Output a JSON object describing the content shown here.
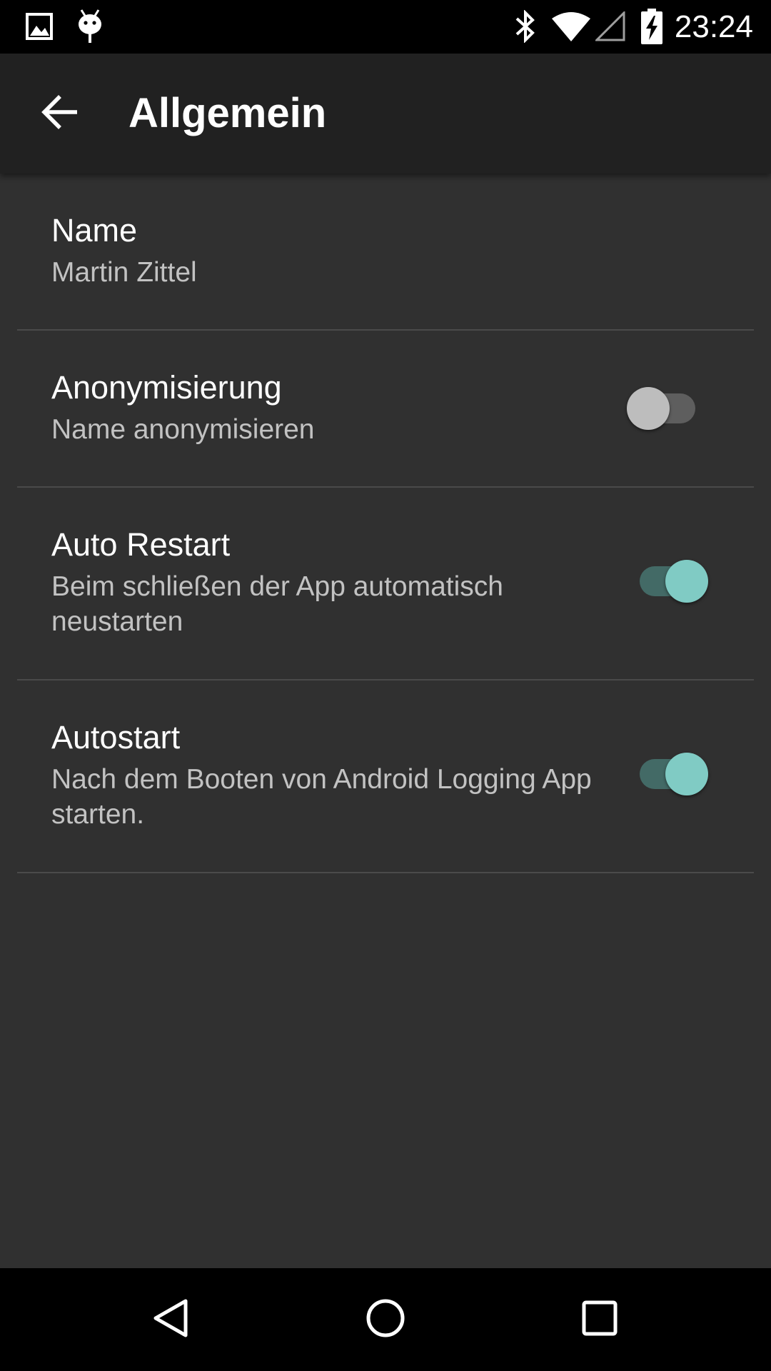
{
  "status_bar": {
    "time": "23:24",
    "left_icons": [
      "image-notification-icon",
      "android-debug-icon"
    ],
    "right_icons": [
      "bluetooth-icon",
      "wifi-icon",
      "cell-signal-icon",
      "battery-charging-icon"
    ]
  },
  "toolbar": {
    "title": "Allgemein",
    "back_icon": "arrow-back-icon"
  },
  "preferences": [
    {
      "title": "Name",
      "summary": "Martin Zittel",
      "has_switch": false
    },
    {
      "title": "Anonymisierung",
      "summary": "Name anonymisieren",
      "has_switch": true,
      "checked": false
    },
    {
      "title": "Auto Restart",
      "summary": "Beim schließen der App automatisch neustarten",
      "has_switch": true,
      "checked": true
    },
    {
      "title": "Autostart",
      "summary": "Nach dem Booten von Android Logging App starten.",
      "has_switch": true,
      "checked": true
    }
  ],
  "nav_bar": {
    "buttons": [
      "back-triangle-icon",
      "home-circle-icon",
      "recents-square-icon"
    ]
  },
  "colors": {
    "background": "#303030",
    "toolbar": "#212121",
    "accent": "#80cbc4",
    "accent_track": "#436a66"
  }
}
